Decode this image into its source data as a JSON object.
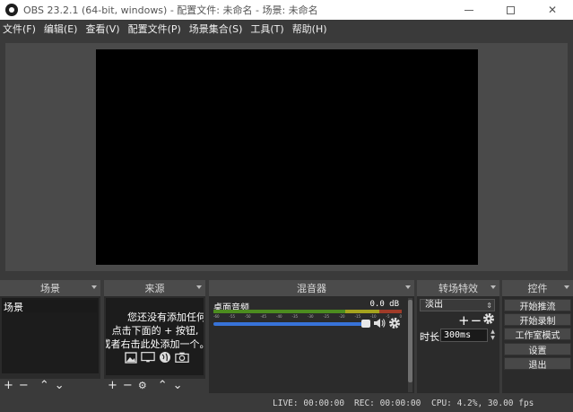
{
  "window": {
    "title": "OBS 23.2.1 (64-bit, windows) - 配置文件: 未命名 - 场景: 未命名"
  },
  "menu": [
    "文件(F)",
    "编辑(E)",
    "查看(V)",
    "配置文件(P)",
    "场景集合(S)",
    "工具(T)",
    "帮助(H)"
  ],
  "docks": {
    "scenes": {
      "title": "场景",
      "items": [
        "场景"
      ]
    },
    "sources": {
      "title": "来源",
      "empty_lines": [
        "您还没有添加任何源。",
        "点击下面的 + 按钮,",
        "或者右击此处添加一个。"
      ]
    },
    "mixer": {
      "title": "混音器",
      "track_name": "桌面音频",
      "track_db": "0.0 dB",
      "ticks": [
        "-60",
        "-55",
        "-50",
        "-45",
        "-40",
        "-35",
        "-30",
        "-25",
        "-20",
        "-15",
        "-10",
        "-5",
        "0"
      ],
      "volume_fraction": 1.0
    },
    "transitions": {
      "title": "转场特效",
      "selected": "淡出",
      "duration_label": "时长",
      "duration_value": "300ms"
    },
    "controls": {
      "title": "控件",
      "buttons": [
        "开始推流",
        "开始录制",
        "工作室模式",
        "设置",
        "退出"
      ]
    }
  },
  "status": {
    "live": "LIVE: 00:00:00",
    "rec": "REC: 00:00:00",
    "cpu": "CPU: 4.2%, 30.00 fps"
  },
  "colors": {
    "meter_green": "#4c8c1f",
    "meter_yellow": "#a5a31e",
    "meter_red": "#a03b28",
    "volume_blue": "#3873d8"
  }
}
